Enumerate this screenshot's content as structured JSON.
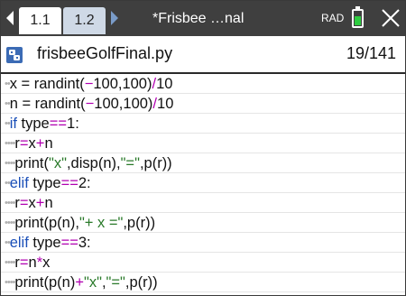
{
  "tabs": [
    {
      "label": "1.1"
    },
    {
      "label": "1.2"
    }
  ],
  "document_title": "*Frisbee …nal",
  "angle_mode": "RAD",
  "battery_level": 0.6,
  "battery_color": "#2ecc40",
  "file": {
    "name": "frisbeeGolfFinal.py",
    "position": "19/141"
  },
  "colors": {
    "keyword": "#1a4fb8",
    "operator": "#b000b0",
    "string": "#2a7a2a",
    "header_bg": "#3f3f3f"
  },
  "code_lines": [
    {
      "indent": "••",
      "parts": [
        "x = randint(",
        "−",
        "100,100)",
        "/",
        "10"
      ]
    },
    {
      "indent": "••",
      "parts": [
        "n = randint(",
        "−",
        "100,100)",
        "/",
        "10"
      ]
    },
    {
      "indent": "••",
      "parts": [
        "if",
        " type",
        "==",
        "1:"
      ]
    },
    {
      "indent": "••••",
      "parts": [
        "r",
        "=",
        "x",
        "+",
        "n"
      ]
    },
    {
      "indent": "••••",
      "parts": [
        "print(",
        "\"x\"",
        ",disp(n),",
        "\"=\"",
        ",p(r))"
      ]
    },
    {
      "indent": "••",
      "parts": [
        "elif",
        " type",
        "==",
        "2:"
      ]
    },
    {
      "indent": "••••",
      "parts": [
        "r",
        "=",
        "x",
        "+",
        "n"
      ]
    },
    {
      "indent": "••••",
      "parts": [
        "print(p(n),",
        "\"+ x =\"",
        ",p(r))"
      ]
    },
    {
      "indent": "••",
      "parts": [
        "elif",
        " type",
        "==",
        "3:"
      ]
    },
    {
      "indent": "••••",
      "parts": [
        "r",
        "=",
        "n",
        "*",
        "x"
      ]
    },
    {
      "indent": "••••",
      "parts": [
        "print(p(n)",
        "+",
        "\"x\"",
        ",",
        "\"=\"",
        ",p(r))"
      ]
    }
  ],
  "icons": {
    "nav_left": "triangle-left-icon",
    "nav_right": "triangle-right-icon",
    "battery": "battery-icon",
    "close": "close-icon",
    "python_file": "python-file-icon"
  }
}
